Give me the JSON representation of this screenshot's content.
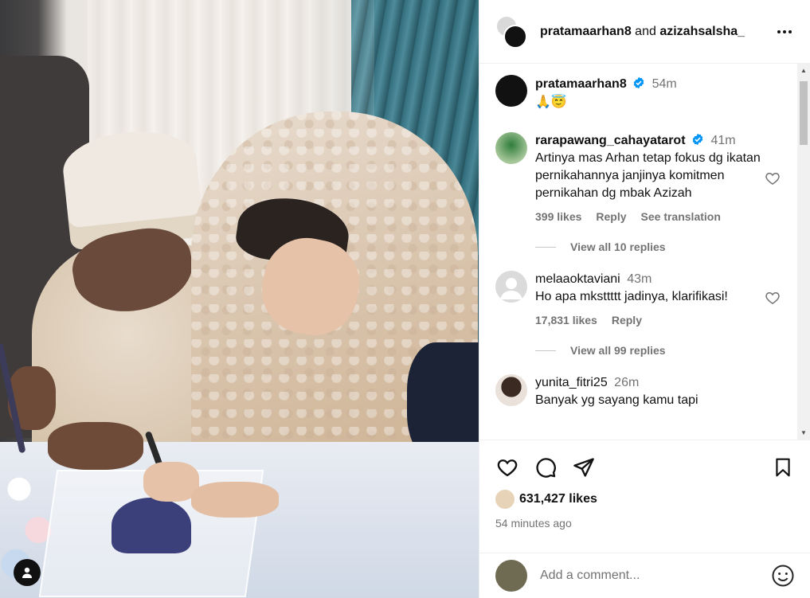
{
  "header": {
    "user1": "pratamaarhan8",
    "connector": "and",
    "user2": "azizahsalsha_"
  },
  "caption": {
    "username": "pratamaarhan8",
    "time": "54m",
    "text": "🙏😇"
  },
  "comments": [
    {
      "username": "rarapawang_cahayatarot",
      "verified": true,
      "time": "41m",
      "text": "Artinya mas Arhan tetap fokus dg ikatan pernikahannya janjinya komitmen pernikahan dg mbak Azizah",
      "likes": "399 likes",
      "reply": "Reply",
      "translate": "See translation",
      "view_replies": "View all 10 replies"
    },
    {
      "username": "melaaoktaviani",
      "verified": false,
      "time": "43m",
      "text": "Ho apa mksttttt jadinya, klarifikasi!",
      "likes": "17,831 likes",
      "reply": "Reply",
      "view_replies": "View all 99 replies"
    },
    {
      "username": "yunita_fitri25",
      "verified": false,
      "time": "26m",
      "text": "Banyak yg sayang kamu tapi"
    }
  ],
  "post": {
    "likes": "631,427 likes",
    "time_ago": "54 minutes ago"
  },
  "add_comment": {
    "placeholder": "Add a comment..."
  },
  "colors": {
    "verified": "#0095f6",
    "text": "#262626",
    "secondary": "#737373"
  }
}
